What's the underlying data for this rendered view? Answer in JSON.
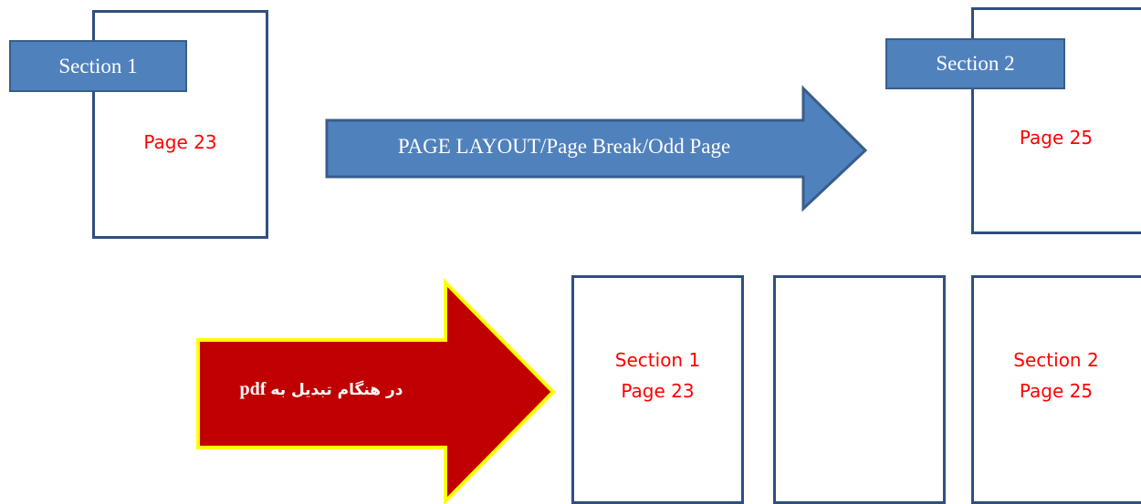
{
  "top_row": {
    "left_page": {
      "section_tab": "Section 1",
      "page_label": "Page 23"
    },
    "arrow": {
      "label": "PAGE LAYOUT/Page Break/Odd Page",
      "fill_color": "#4f81bd"
    },
    "right_page": {
      "section_tab": "Section 2",
      "page_label": "Page 25"
    }
  },
  "bottom_row": {
    "arrow": {
      "label_rtl": "در هنگام تبدیل به",
      "label_ltr": "pdf",
      "fill_color": "#c00000",
      "outline_color": "#ffff00"
    },
    "pages": [
      {
        "line1": "Section 1",
        "line2": "Page 23"
      },
      {
        "line1": "",
        "line2": ""
      },
      {
        "line1": "Section 2",
        "line2": "Page 25"
      }
    ]
  },
  "colors": {
    "page_border": "#2f4f7f",
    "tab_fill": "#4f81bd",
    "red_text": "#ff0000"
  }
}
